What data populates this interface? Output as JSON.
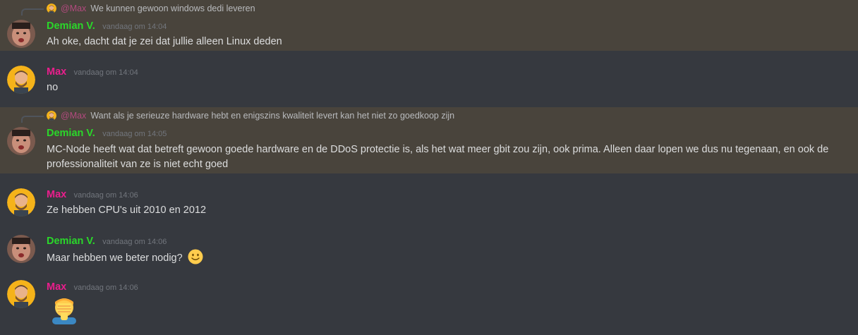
{
  "messages": [
    {
      "author": "Demian V.",
      "timestamp": "vandaag om 14:04",
      "reply_to": {
        "mention": "@Max",
        "text": "We kunnen gewoon windows dedi leveren"
      },
      "text": "Ah oke, dacht dat je zei dat jullie alleen Linux deden"
    },
    {
      "author": "Max",
      "timestamp": "vandaag om 14:04",
      "text": "no"
    },
    {
      "author": "Demian V.",
      "timestamp": "vandaag om 14:05",
      "reply_to": {
        "mention": "@Max",
        "text": "Want als je serieuze hardware hebt en enigszins kwaliteit levert kan het niet zo goedkoop zijn"
      },
      "text_line1": "MC-Node heeft wat dat betreft gewoon goede hardware en de DDoS protectie is, als het wat meer gbit zou zijn, ook prima. Alleen daar lopen we dus nu tegenaan, en ook de",
      "text_line2": "professionaliteit van ze is niet echt goed"
    },
    {
      "author": "Max",
      "timestamp": "vandaag om 14:06",
      "text": "Ze hebben CPU's uit 2010 en 2012"
    },
    {
      "author": "Demian V.",
      "timestamp": "vandaag om 14:06",
      "text": "Maar hebben we beter nodig?",
      "emoji": "slightly-smiling-face-icon"
    },
    {
      "author": "Max",
      "timestamp": "vandaag om 14:06",
      "emoji": "facepalm-icon"
    }
  ],
  "colors": {
    "background": "#36393f",
    "mention_highlight": "#49443c",
    "demian": "#2ad82a",
    "max": "#e91e8c",
    "timestamp": "#72767d"
  }
}
